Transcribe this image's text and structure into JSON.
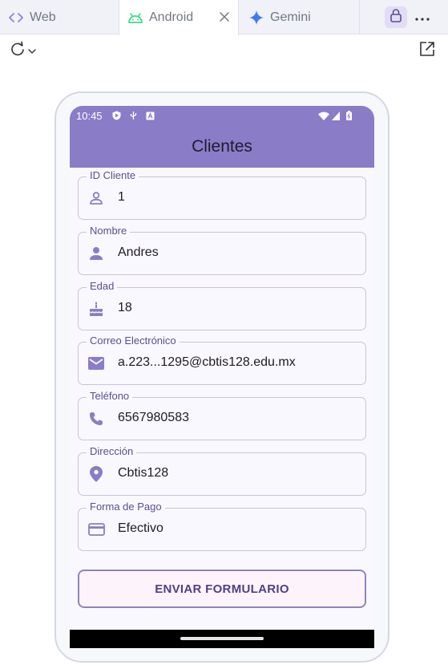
{
  "tabs": [
    {
      "label": "Web",
      "icon": "code-icon"
    },
    {
      "label": "Android",
      "icon": "android-icon"
    },
    {
      "label": "Gemini",
      "icon": "gemini-sparkle-icon"
    }
  ],
  "colors": {
    "appbar": "#8b7cc8",
    "accent": "#5b4f8f",
    "icon": "#8b7cc8"
  },
  "phone": {
    "status_time": "10:45",
    "app_title": "Clientes",
    "fields": [
      {
        "label": "ID Cliente",
        "value": "1",
        "icon": "person-outline-icon"
      },
      {
        "label": "Nombre",
        "value": "Andres",
        "icon": "person-icon"
      },
      {
        "label": "Edad",
        "value": "18",
        "icon": "cake-icon"
      },
      {
        "label": "Correo Electrónico",
        "value": "a.223...1295@cbtis128.edu.mx",
        "icon": "email-icon"
      },
      {
        "label": "Teléfono",
        "value": "6567980583",
        "icon": "phone-icon"
      },
      {
        "label": "Dirección",
        "value": "Cbtis128",
        "icon": "location-pin-icon"
      },
      {
        "label": "Forma de Pago",
        "value": "Efectivo",
        "icon": "credit-card-icon"
      }
    ],
    "submit_label": "ENVIAR FORMULARIO"
  }
}
